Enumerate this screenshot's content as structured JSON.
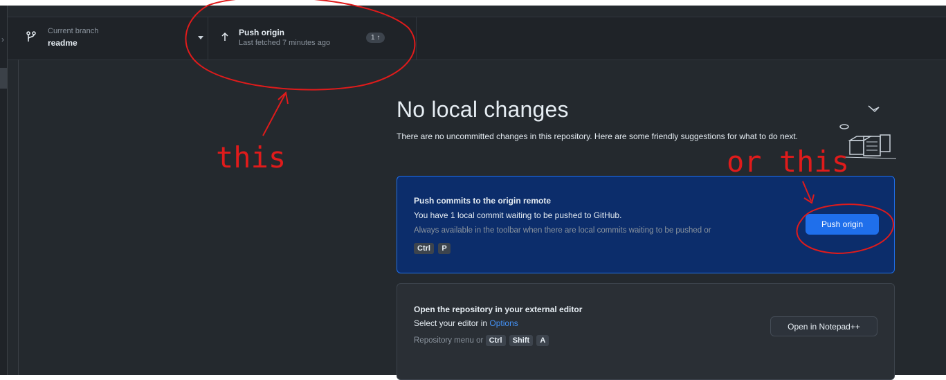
{
  "toolbar": {
    "branch": {
      "label": "Current branch",
      "value": "readme"
    },
    "push": {
      "label": "Push origin",
      "subtitle": "Last fetched 7 minutes ago",
      "badge": "1 ↑"
    }
  },
  "main": {
    "title": "No local changes",
    "description": "There are no uncommitted changes in this repository. Here are some friendly suggestions for what to do next.",
    "push_card": {
      "title": "Push commits to the origin remote",
      "line": "You have 1 local commit waiting to be pushed to GitHub.",
      "muted": "Always available in the toolbar when there are local commits waiting to be pushed or",
      "shortcut": [
        "Ctrl",
        "P"
      ],
      "button": "Push origin"
    },
    "editor_card": {
      "title": "Open the repository in your external editor",
      "line_prefix": "Select your editor in ",
      "line_link": "Options",
      "muted_prefix": "Repository menu or",
      "shortcut": [
        "Ctrl",
        "Shift",
        "A"
      ],
      "button": "Open in Notepad++"
    }
  },
  "annotations": {
    "left": "this",
    "right": "or this"
  },
  "colors": {
    "accent": "#1f6feb",
    "annotation": "#e01b1b",
    "background": "#24292e"
  }
}
